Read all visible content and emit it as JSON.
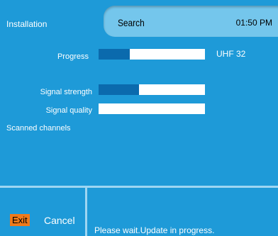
{
  "header": {
    "title": "Installation",
    "tab": "Search",
    "time": "01:50 PM"
  },
  "progress": {
    "label": "Progress",
    "value": 0.29,
    "channel": "UHF 32"
  },
  "signal_strength": {
    "label": "Signal strength",
    "value": 0.38
  },
  "signal_quality": {
    "label": "Signal quality",
    "value": 0.0
  },
  "scanned": {
    "label": "Scanned channels"
  },
  "footer": {
    "exit_key": "Exit",
    "cancel_label": "Cancel",
    "status": "Please wait.Update in progress."
  },
  "colors": {
    "background": "#1e9ad8",
    "tab": "#74c6ec",
    "bar_fill": "#0b6aad",
    "exit_key": "#f07a1a"
  }
}
